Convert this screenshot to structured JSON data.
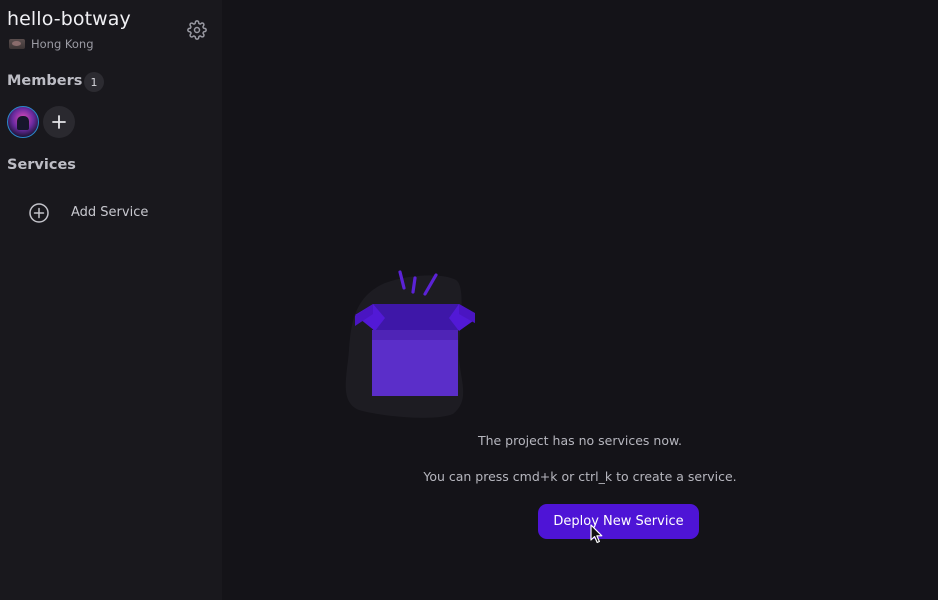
{
  "project": {
    "title": "hello-botway",
    "region": "Hong Kong"
  },
  "sidebar": {
    "members_label": "Members",
    "members_count": "1",
    "services_label": "Services",
    "add_service_label": "Add Service"
  },
  "main": {
    "empty_message": "The project has no services now.",
    "hint_message": "You can press cmd+k or ctrl_k to create a service.",
    "deploy_button_label": "Deploy New Service"
  },
  "colors": {
    "background": "#141318",
    "sidebar": "#19181d",
    "accent": "#4e14d6",
    "box_purple": "#5b2ec9"
  },
  "icons": [
    "settings-gear-icon",
    "add-icon",
    "plus-circle-icon",
    "open-box-icon",
    "mouse-pointer-icon"
  ]
}
